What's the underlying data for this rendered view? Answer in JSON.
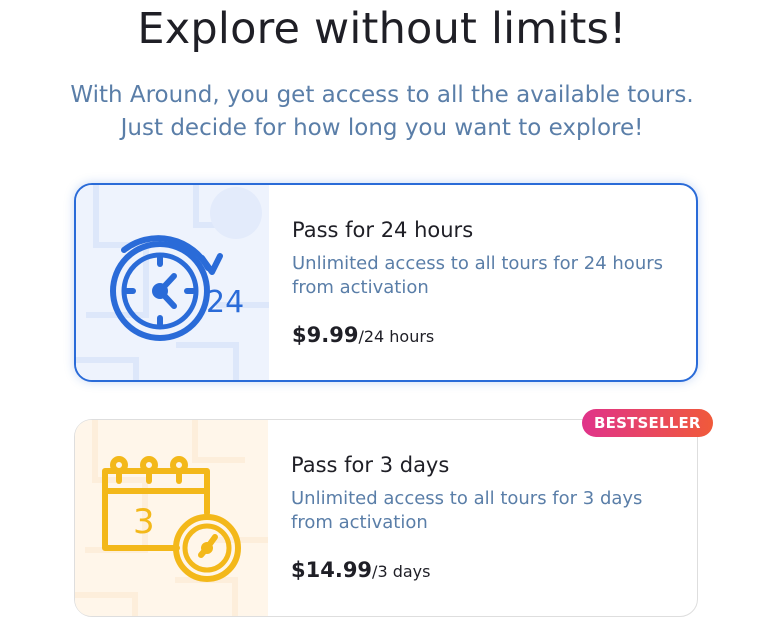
{
  "header": {
    "title": "Explore without limits!",
    "subtitle": "With Around, you get access to all the available tours. Just decide for how long you want to explore!"
  },
  "plans": [
    {
      "title": "Pass for 24 hours",
      "description": "Unlimited access to all tours for 24 hours from activation",
      "price": "$9.99",
      "period": "/24 hours",
      "icon": "clock-24-icon",
      "icon_label": "24",
      "selected": true
    },
    {
      "title": "Pass for 3 days",
      "description": "Unlimited access to all tours for 3 days from activation",
      "price": "$14.99",
      "period": "/3 days",
      "icon": "calendar-clock-icon",
      "icon_label": "3",
      "badge": "BESTSELLER",
      "selected": false
    }
  ],
  "colors": {
    "title": "#1f1f26",
    "subtitle": "#5a7ea8",
    "selected_border": "#2a6bd8",
    "icon_blue": "#2a6bd8",
    "icon_yellow": "#f3b81a",
    "badge_start": "#e0338a",
    "badge_end": "#f05a3a"
  }
}
